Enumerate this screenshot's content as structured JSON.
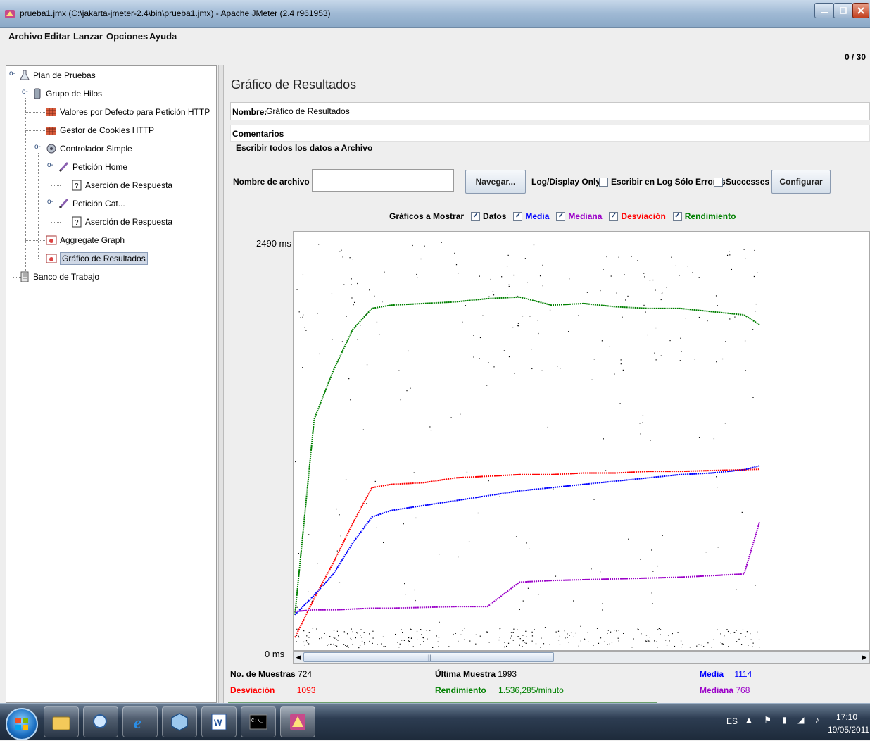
{
  "window": {
    "title": "prueba1.jmx (C:\\jakarta-jmeter-2.4\\bin\\prueba1.jmx) - Apache JMeter (2.4 r961953)"
  },
  "menu": {
    "items": [
      "Archivo",
      "Editar",
      "Lanzar",
      "Opciones",
      "Ayuda"
    ]
  },
  "counter": "0 / 30",
  "tree": {
    "items": [
      {
        "label": "Plan de Pruebas",
        "icon": "test-plan-icon"
      },
      {
        "label": "Grupo de Hilos",
        "icon": "thread-group-icon"
      },
      {
        "label": "Valores por Defecto para Petición HTTP",
        "icon": "config-element-icon"
      },
      {
        "label": "Gestor de Cookies HTTP",
        "icon": "cookie-manager-icon"
      },
      {
        "label": "Controlador Simple",
        "icon": "controller-icon"
      },
      {
        "label": "Petición Home",
        "icon": "sampler-icon"
      },
      {
        "label": "Aserción de Respuesta",
        "icon": "assertion-icon"
      },
      {
        "label": "Petición Cat...",
        "icon": "sampler-icon"
      },
      {
        "label": "Aserción de Respuesta",
        "icon": "assertion-icon"
      },
      {
        "label": "Aggregate Graph",
        "icon": "listener-icon"
      },
      {
        "label": "Gráfico de Resultados",
        "icon": "listener-icon"
      },
      {
        "label": "Banco de Trabajo",
        "icon": "workbench-icon"
      }
    ],
    "selected": "Gráfico de Resultados"
  },
  "panel": {
    "title": "Gráfico de Resultados",
    "name_label": "Nombre:",
    "name_value": "Gráfico de Resultados",
    "comments_label": "Comentarios",
    "file_group_title": "Escribir todos los datos a Archivo",
    "file_label": "Nombre de archivo",
    "file_value": "",
    "browse_label": "Navegar...",
    "log_display_label": "Log/Display Only:",
    "errors_only_label": "Escribir en Log Sólo Errores",
    "errors_only_checked": false,
    "successes_label": "Successes",
    "successes_checked": false,
    "configure_label": "Configurar"
  },
  "graph_options": {
    "label": "Gráficos a Mostrar",
    "items": [
      {
        "label": "Datos",
        "checked": true,
        "color": "#000000"
      },
      {
        "label": "Media",
        "checked": true,
        "color": "#0000ff"
      },
      {
        "label": "Mediana",
        "checked": true,
        "color": "#9b00c8"
      },
      {
        "label": "Desviación",
        "checked": true,
        "color": "#ff0000"
      },
      {
        "label": "Rendimiento",
        "checked": true,
        "color": "#008000"
      }
    ]
  },
  "chart_data": {
    "type": "line",
    "ylim_labels": [
      "2490 ms",
      "0 ms"
    ],
    "ylim": [
      0,
      2490
    ],
    "x_samples": [
      0,
      30,
      60,
      90,
      120,
      150,
      200,
      250,
      300,
      350,
      400,
      450,
      500,
      550,
      600,
      650,
      700,
      724
    ],
    "series": [
      {
        "name": "Rendimiento",
        "color": "#008000",
        "values": [
          200,
          1400,
          1700,
          1950,
          2080,
          2100,
          2110,
          2120,
          2140,
          2150,
          2100,
          2110,
          2090,
          2080,
          2080,
          2060,
          2040,
          1980
        ]
      },
      {
        "name": "Desviación",
        "color": "#ff0000",
        "values": [
          60,
          300,
          520,
          760,
          980,
          1000,
          1010,
          1040,
          1050,
          1060,
          1060,
          1070,
          1070,
          1080,
          1080,
          1085,
          1090,
          1093
        ]
      },
      {
        "name": "Media",
        "color": "#0000ff",
        "values": [
          200,
          320,
          450,
          640,
          800,
          840,
          870,
          900,
          930,
          960,
          980,
          1000,
          1020,
          1040,
          1060,
          1070,
          1090,
          1114
        ]
      },
      {
        "name": "Mediana",
        "color": "#9b00c8",
        "values": [
          220,
          230,
          230,
          235,
          240,
          240,
          245,
          250,
          250,
          400,
          410,
          415,
          420,
          425,
          430,
          440,
          450,
          768
        ]
      }
    ]
  },
  "stats": {
    "samples_label": "No. de Muestras",
    "samples_value": "724",
    "last_label": "Última Muestra",
    "last_value": "1993",
    "mean_label": "Media",
    "mean_value": "1114",
    "deviation_label": "Desviación",
    "deviation_value": "1093",
    "throughput_label": "Rendimiento",
    "throughput_value": "1.536,285/minuto",
    "median_label": "Mediana",
    "median_value": "768"
  },
  "taskbar": {
    "items": [
      "explorer-icon",
      "ie-search-icon",
      "internet-explorer-icon",
      "virtualbox-icon",
      "word-icon",
      "cmd-icon",
      "jmeter-icon"
    ],
    "language": "ES",
    "time": "17:10",
    "date": "19/05/2011"
  }
}
